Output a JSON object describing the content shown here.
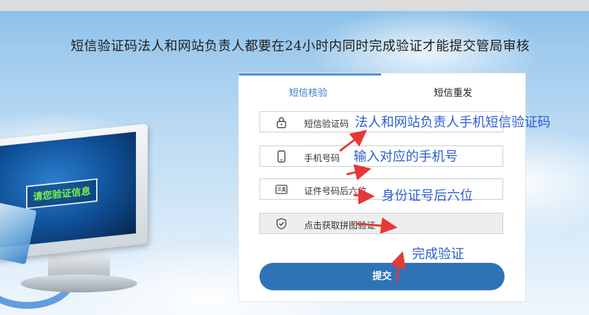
{
  "headline": "短信验证码法人和网站负责人都要在24小时内同时完成验证才能提交管局审核",
  "illustration": {
    "screen_text": "请您验证信息"
  },
  "tabs": {
    "verify": "短信核验",
    "resend": "短信重发"
  },
  "fields": {
    "sms_code": {
      "label": "短信验证码",
      "icon": "lock-icon"
    },
    "phone": {
      "label": "手机号码",
      "icon": "phone-icon"
    },
    "id_number": {
      "label": "证件号码后六位",
      "icon": "id-card-icon"
    },
    "captcha": {
      "label": "点击获取拼图验证",
      "icon": "shield-icon"
    }
  },
  "submit_label": "提交",
  "annotations": {
    "sms_code": "法人和网站负责人手机短信验证码",
    "phone": "输入对应的手机号",
    "id_number": "身份证号后六位",
    "complete": "完成验证"
  },
  "colors": {
    "accent": "#2f73b7",
    "annotation": "#2f5fd0",
    "arrow": "#e53935",
    "screen_text": "#7cf04a"
  }
}
